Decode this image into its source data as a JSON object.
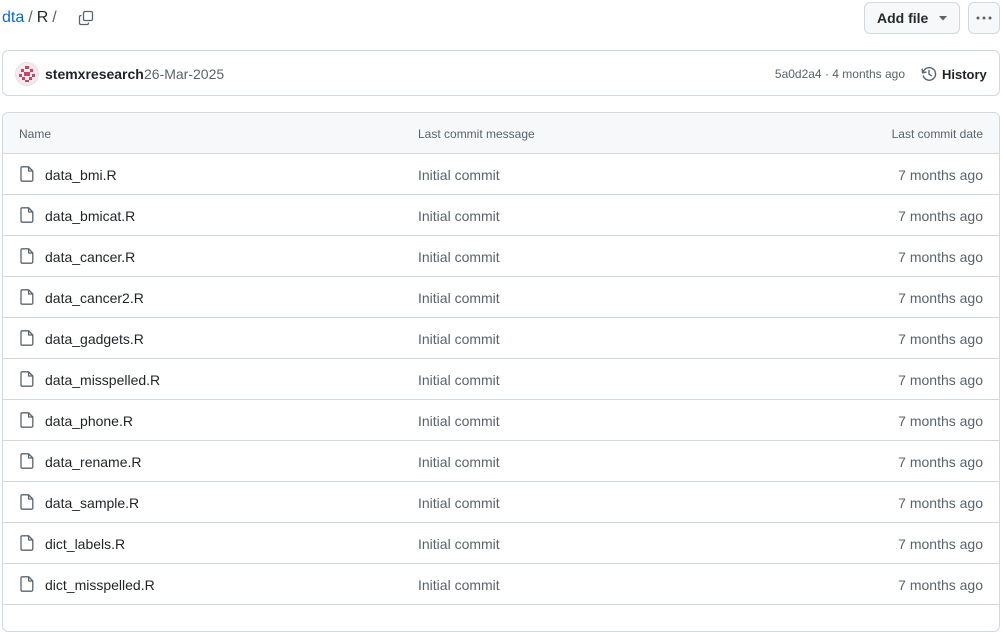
{
  "breadcrumb": {
    "repo": "dta",
    "separator": "/",
    "directory": "R",
    "trailing_separator": "/"
  },
  "toolbar": {
    "add_file_label": "Add file",
    "more_icon": "kebab-horizontal-icon",
    "copy_icon": "copy-icon"
  },
  "latest_commit": {
    "author": "stemxresearch",
    "date": "26-Mar-2025",
    "meta": "5a0d2a4 · 4 months ago",
    "history_label": "History",
    "history_icon": "history-icon"
  },
  "table": {
    "headers": {
      "name": "Name",
      "message": "Last commit message",
      "date": "Last commit date"
    },
    "rows": [
      {
        "name": "data_bmi.R",
        "message": "Initial commit",
        "date": "7 months ago"
      },
      {
        "name": "data_bmicat.R",
        "message": "Initial commit",
        "date": "7 months ago"
      },
      {
        "name": "data_cancer.R",
        "message": "Initial commit",
        "date": "7 months ago"
      },
      {
        "name": "data_cancer2.R",
        "message": "Initial commit",
        "date": "7 months ago"
      },
      {
        "name": "data_gadgets.R",
        "message": "Initial commit",
        "date": "7 months ago"
      },
      {
        "name": "data_misspelled.R",
        "message": "Initial commit",
        "date": "7 months ago"
      },
      {
        "name": "data_phone.R",
        "message": "Initial commit",
        "date": "7 months ago"
      },
      {
        "name": "data_rename.R",
        "message": "Initial commit",
        "date": "7 months ago"
      },
      {
        "name": "data_sample.R",
        "message": "Initial commit",
        "date": "7 months ago"
      },
      {
        "name": "dict_labels.R",
        "message": "Initial commit",
        "date": "7 months ago"
      },
      {
        "name": "dict_misspelled.R",
        "message": "Initial commit",
        "date": "7 months ago"
      }
    ]
  },
  "colors": {
    "link": "#0969da",
    "border": "#d1d9e0",
    "muted_text": "#59636e",
    "header_bg": "#f6f8fa"
  }
}
